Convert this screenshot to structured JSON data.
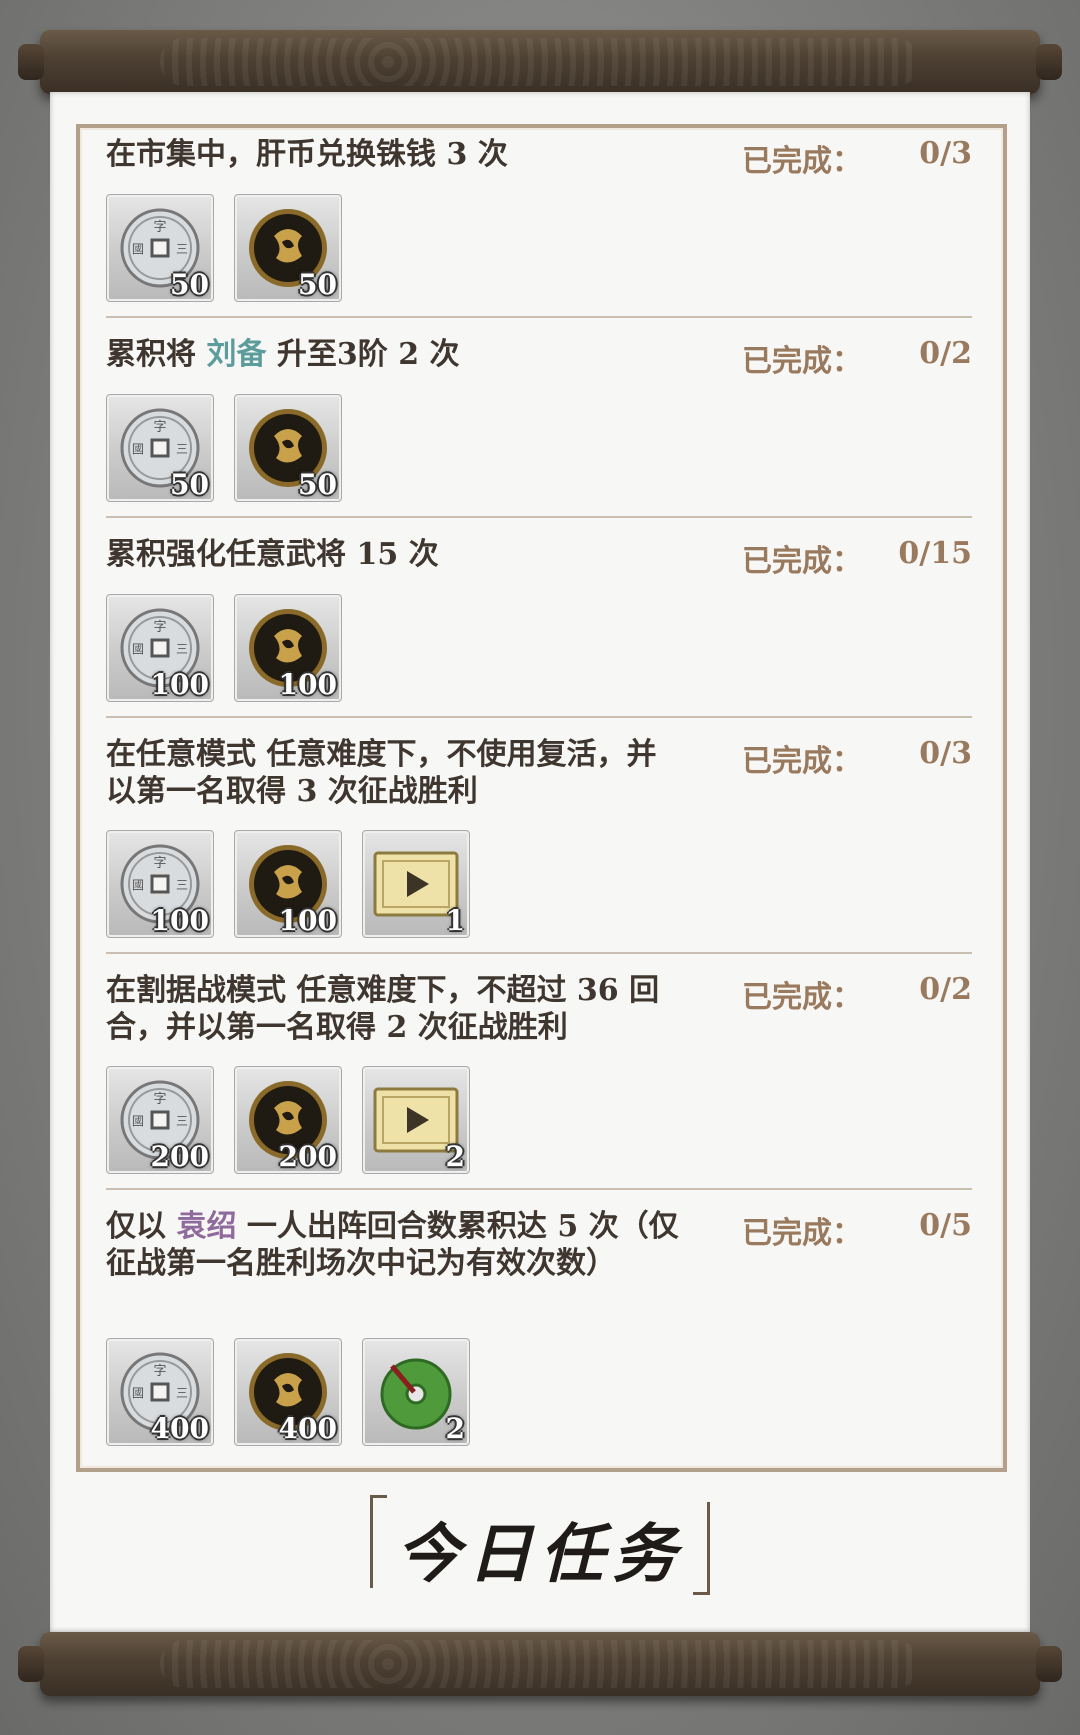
{
  "status_label": "已完成：",
  "title": "今日任务",
  "colors": {
    "accent_brown": "#9a7a5e",
    "highlight_teal": "#5c9c9c",
    "highlight_purple": "#8f6a9d"
  },
  "quests": [
    {
      "desc_parts": [
        "在市集中，肝币兑换铢钱 3 次"
      ],
      "progress": "0/3",
      "rewards": [
        {
          "icon": "silver-coin-icon",
          "qty": "50"
        },
        {
          "icon": "gold-coin-icon",
          "qty": "50"
        }
      ]
    },
    {
      "desc_parts": [
        "累积将 ",
        "刘备",
        " 升至3阶 2 次"
      ],
      "progress": "0/2",
      "rewards": [
        {
          "icon": "silver-coin-icon",
          "qty": "50"
        },
        {
          "icon": "gold-coin-icon",
          "qty": "50"
        }
      ]
    },
    {
      "desc_parts": [
        "累积强化任意武将 15 次"
      ],
      "progress": "0/15",
      "rewards": [
        {
          "icon": "silver-coin-icon",
          "qty": "100"
        },
        {
          "icon": "gold-coin-icon",
          "qty": "100"
        }
      ]
    },
    {
      "desc_parts": [
        "在任意模式 任意难度下，不使用复活，并以第一名取得 3 次征战胜利"
      ],
      "progress": "0/3",
      "rewards": [
        {
          "icon": "silver-coin-icon",
          "qty": "100"
        },
        {
          "icon": "gold-coin-icon",
          "qty": "100"
        },
        {
          "icon": "play-ticket-icon",
          "qty": "1"
        }
      ]
    },
    {
      "desc_parts": [
        "在割据战模式 任意难度下，不超过 36 回合，并以第一名取得 2 次征战胜利"
      ],
      "progress": "0/2",
      "rewards": [
        {
          "icon": "silver-coin-icon",
          "qty": "200"
        },
        {
          "icon": "gold-coin-icon",
          "qty": "200"
        },
        {
          "icon": "play-ticket-icon",
          "qty": "2"
        }
      ]
    },
    {
      "desc_parts": [
        "仅以 ",
        "袁绍",
        " 一人出阵回合数累积达 5 次（仅征战第一名胜利场次中记为有效次数）"
      ],
      "progress": "0/5",
      "rewards": [
        {
          "icon": "silver-coin-icon",
          "qty": "400"
        },
        {
          "icon": "gold-coin-icon",
          "qty": "400"
        },
        {
          "icon": "jade-disc-icon",
          "qty": "2"
        }
      ]
    }
  ]
}
